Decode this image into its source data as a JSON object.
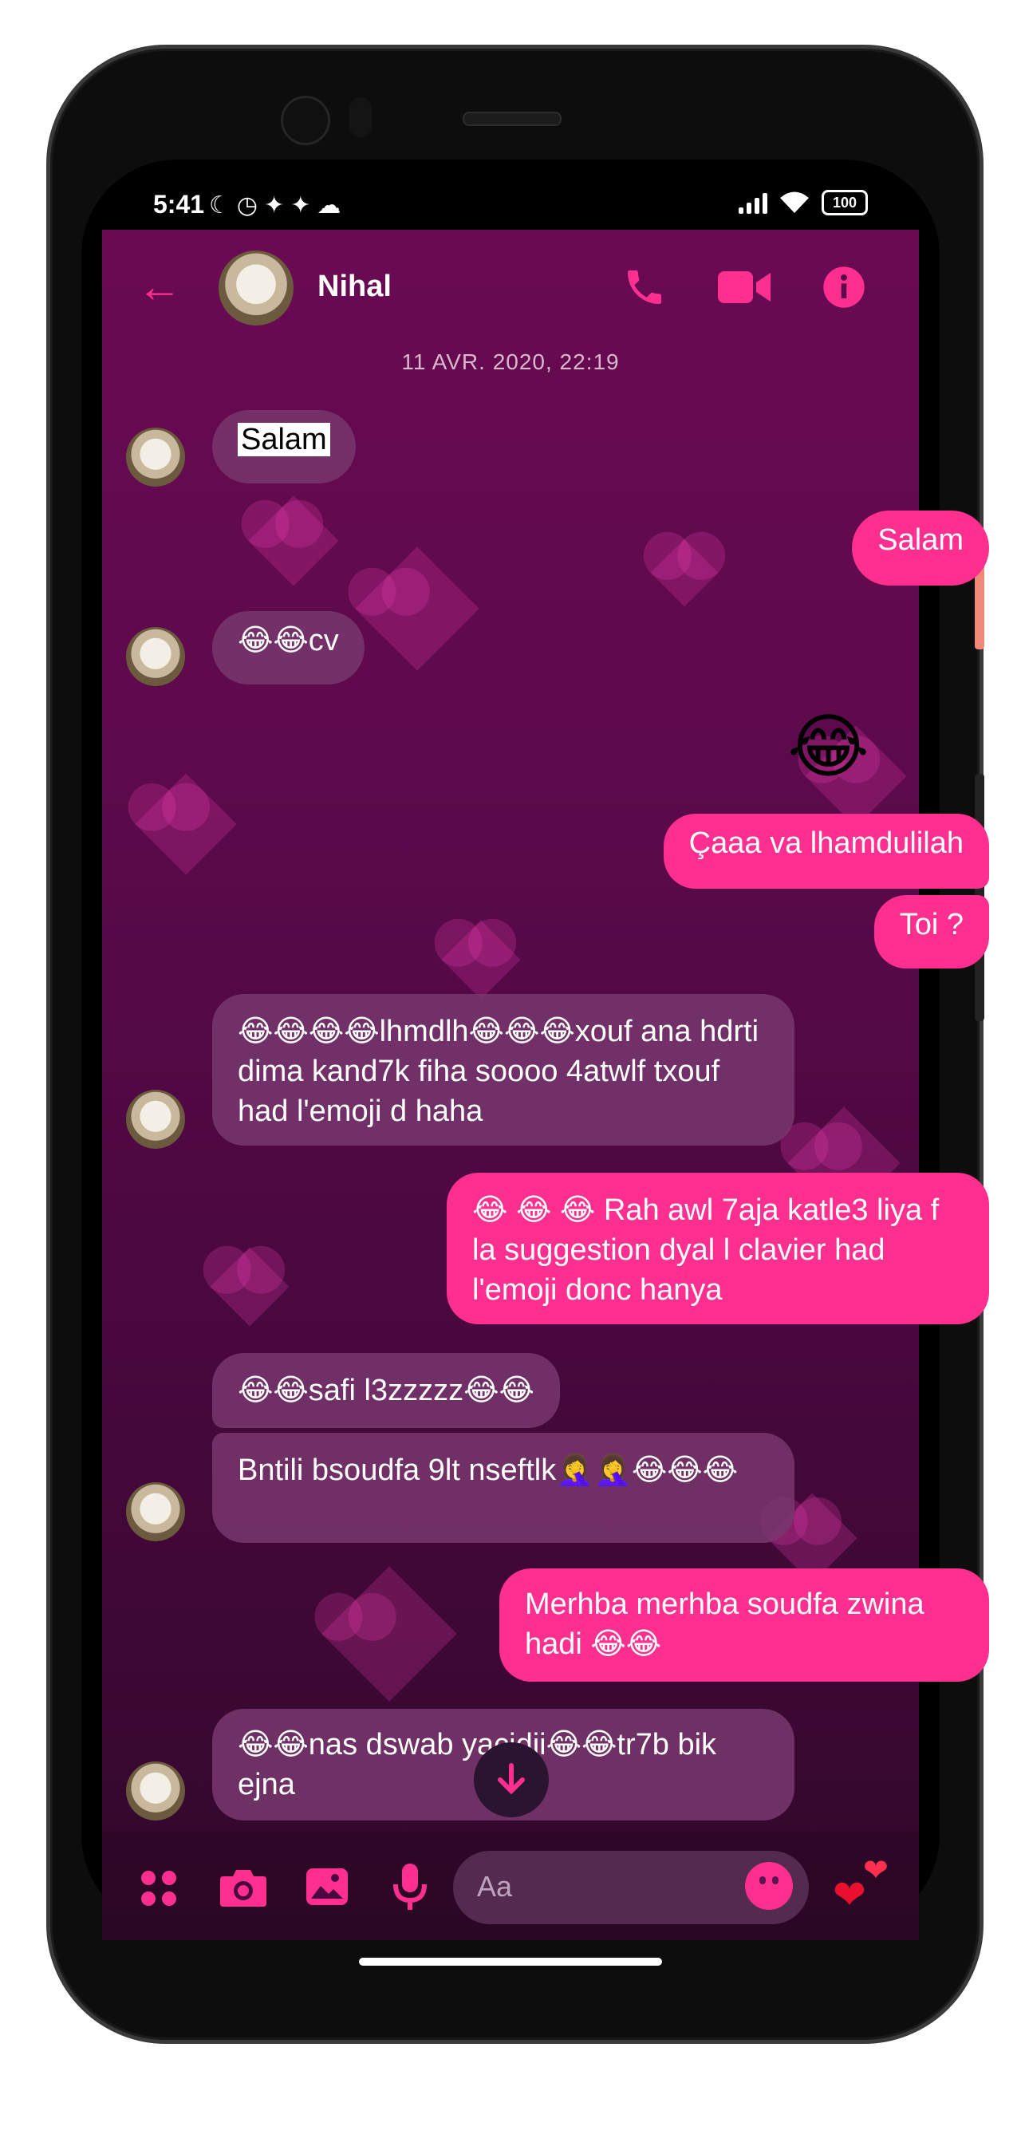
{
  "status": {
    "time": "5:41",
    "battery": "100",
    "icons": [
      "moon-icon",
      "alarm-icon",
      "twitter-icon",
      "twitter-icon",
      "snapchat-icon"
    ]
  },
  "header": {
    "name": "Nihal",
    "back": "←",
    "call": "☎",
    "video": "■",
    "info": "i"
  },
  "timestamp": "11 AVR. 2020, 22:19",
  "messages": {
    "m1": "Salam",
    "m2": "Salam",
    "m3": "😂😂cv",
    "m4": "😂",
    "m5": "Çaaa va lhamdulilah",
    "m6": "Toi ?",
    "m7": "😂😂😂😂lhmdlh😂😂😂xouf ana hdrti dima kand7k fiha soooo 4atwlf txouf had l'emoji d haha",
    "m8": "😂 😂 😂 Rah awl 7aja katle3 liya f la suggestion dyal l clavier had l'emoji donc hanya",
    "m9": "😂😂safi l3zzzzz😂😂",
    "m10": "Bntili bsoudfa 9lt nseftlk🤦‍♀️🤦‍♀️😂😂😂",
    "m11": "Merhba merhba soudfa zwina hadi 😂😂",
    "m12": "😂😂nas dswab yacidii😂😂tr7b bik ejna"
  },
  "composer": {
    "placeholder": "Aa",
    "like": "❤"
  },
  "colors": {
    "accent": "#ff2f8f",
    "background": "#5d0a4c",
    "received_bubble": "#78376e"
  }
}
